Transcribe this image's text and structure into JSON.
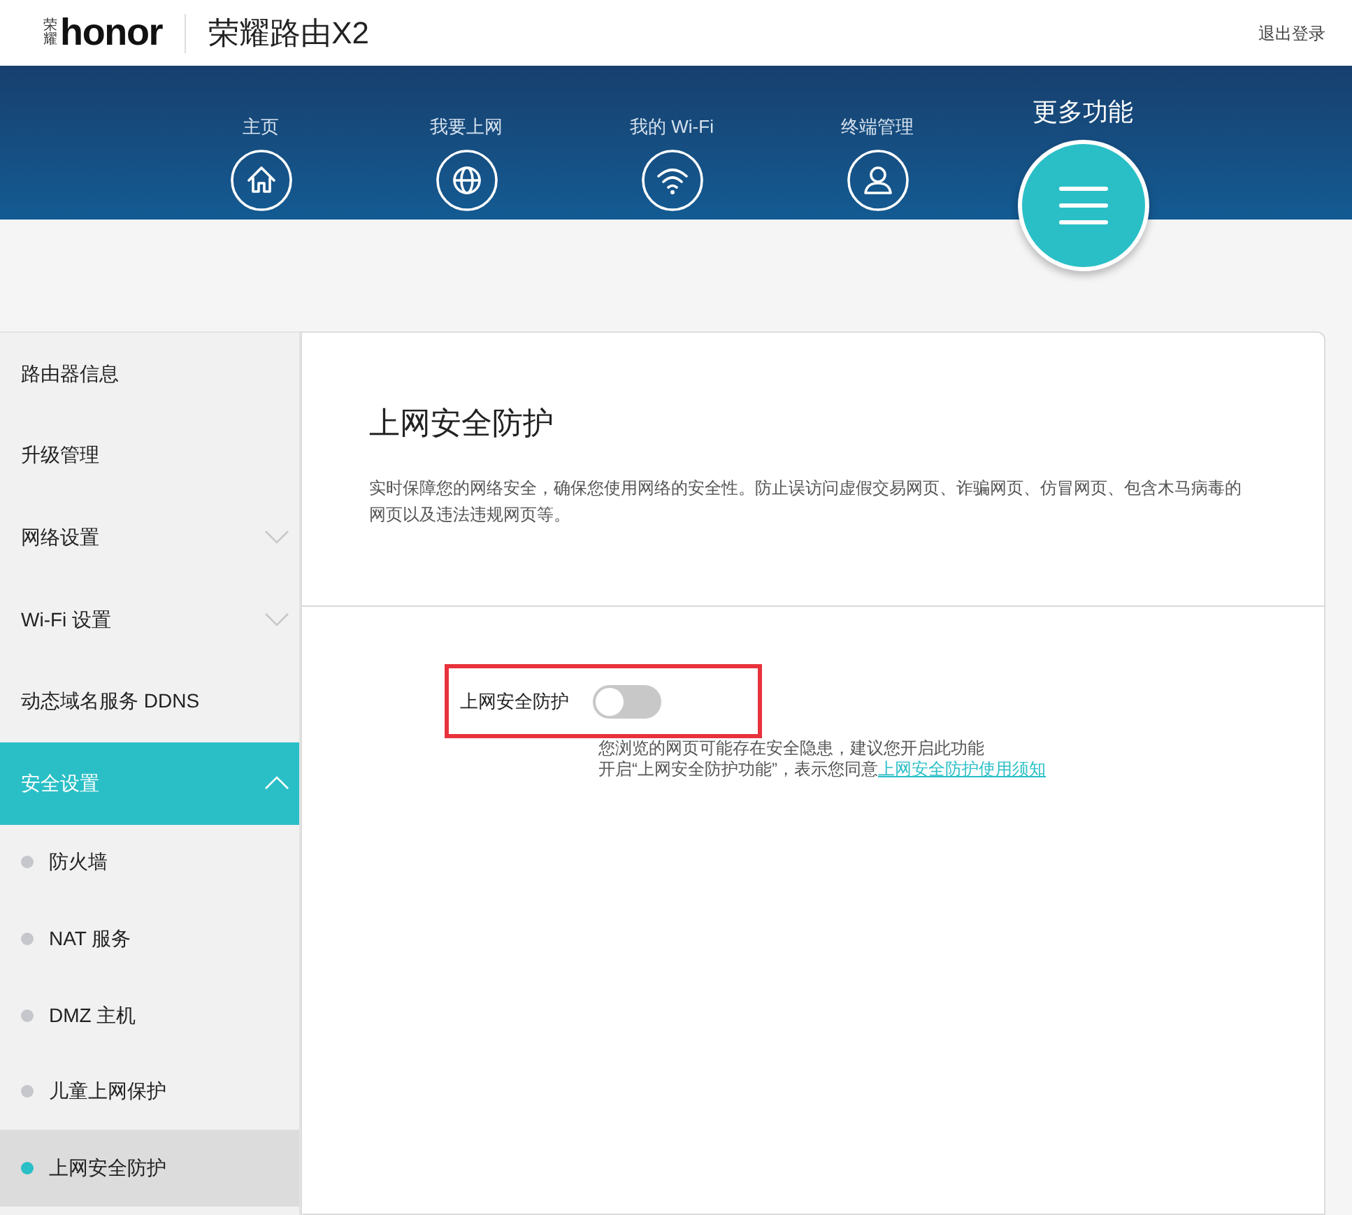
{
  "header": {
    "logo_mark": "荣耀",
    "logo_wordmark": "honor",
    "product": "荣耀路由X2",
    "logout": "退出登录"
  },
  "nav": [
    {
      "label": "主页",
      "kind": "home",
      "selected": false
    },
    {
      "label": "我要上网",
      "kind": "globe",
      "selected": false
    },
    {
      "label": "我的 Wi-Fi",
      "kind": "wifi",
      "selected": false
    },
    {
      "label": "终端管理",
      "kind": "user",
      "selected": false
    },
    {
      "label": "更多功能",
      "kind": "menu",
      "selected": true
    }
  ],
  "sidebar": {
    "items": [
      {
        "label": "路由器信息",
        "selected": false
      },
      {
        "label": "升级管理",
        "selected": false
      },
      {
        "label": "网络设置",
        "selected": false,
        "expanded": false
      },
      {
        "label": "Wi-Fi 设置",
        "selected": false,
        "expanded": false
      },
      {
        "label": "动态域名服务 DDNS",
        "selected": false
      },
      {
        "label": "安全设置",
        "selected": true,
        "expanded": true,
        "children": [
          {
            "label": "防火墙",
            "selected": false
          },
          {
            "label": "NAT 服务",
            "selected": false
          },
          {
            "label": "DMZ 主机",
            "selected": false
          },
          {
            "label": "儿童上网保护",
            "selected": false
          },
          {
            "label": "上网安全防护",
            "selected": true
          }
        ]
      }
    ]
  },
  "content": {
    "title": "上网安全防护",
    "description": "实时保障您的网络安全，确保您使用网络的安全性。防止误访问虚假交易网页、诈骗网页、仿冒网页、包含木马病毒的网页以及违法违规网页等。",
    "setting": {
      "label": "上网安全防护",
      "on": false,
      "hint": "您浏览的网页可能存在安全隐患，建议您开启此功能",
      "agreement": "开启“上网安全防护功能”，表示您同意",
      "link": "上网安全防护使用须知"
    }
  }
}
